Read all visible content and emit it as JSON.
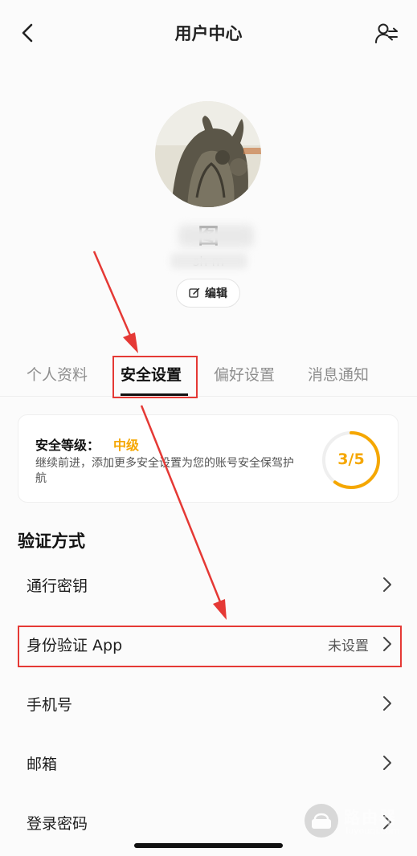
{
  "header": {
    "title": "用户中心",
    "back_icon": "chevron-left-icon",
    "user_switch_icon": "user-switch-icon"
  },
  "profile": {
    "name": "图",
    "email": "sh m",
    "edit_label": "编辑"
  },
  "tabs": [
    {
      "label": "个人资料",
      "active": false
    },
    {
      "label": "安全设置",
      "active": true
    },
    {
      "label": "偏好设置",
      "active": false
    },
    {
      "label": "消息通知",
      "active": false
    }
  ],
  "security": {
    "label": "安全等级：",
    "level": "中级",
    "desc": "继续前进，添加更多安全设置为您的账号安全保驾护航",
    "score": "3/5",
    "progress": 0.6,
    "accent": "#f5a700"
  },
  "verification": {
    "title": "验证方式",
    "items": [
      {
        "label": "通行密钥",
        "value": ""
      },
      {
        "label": "身份验证 App",
        "value": "未设置"
      },
      {
        "label": "手机号",
        "value": ""
      },
      {
        "label": "邮箱",
        "value": ""
      },
      {
        "label": "登录密码",
        "value": ""
      }
    ]
  },
  "annotation": {
    "color": "#e53935"
  },
  "watermark": {
    "title": "路由器",
    "subtitle": "luyouqi.com"
  }
}
